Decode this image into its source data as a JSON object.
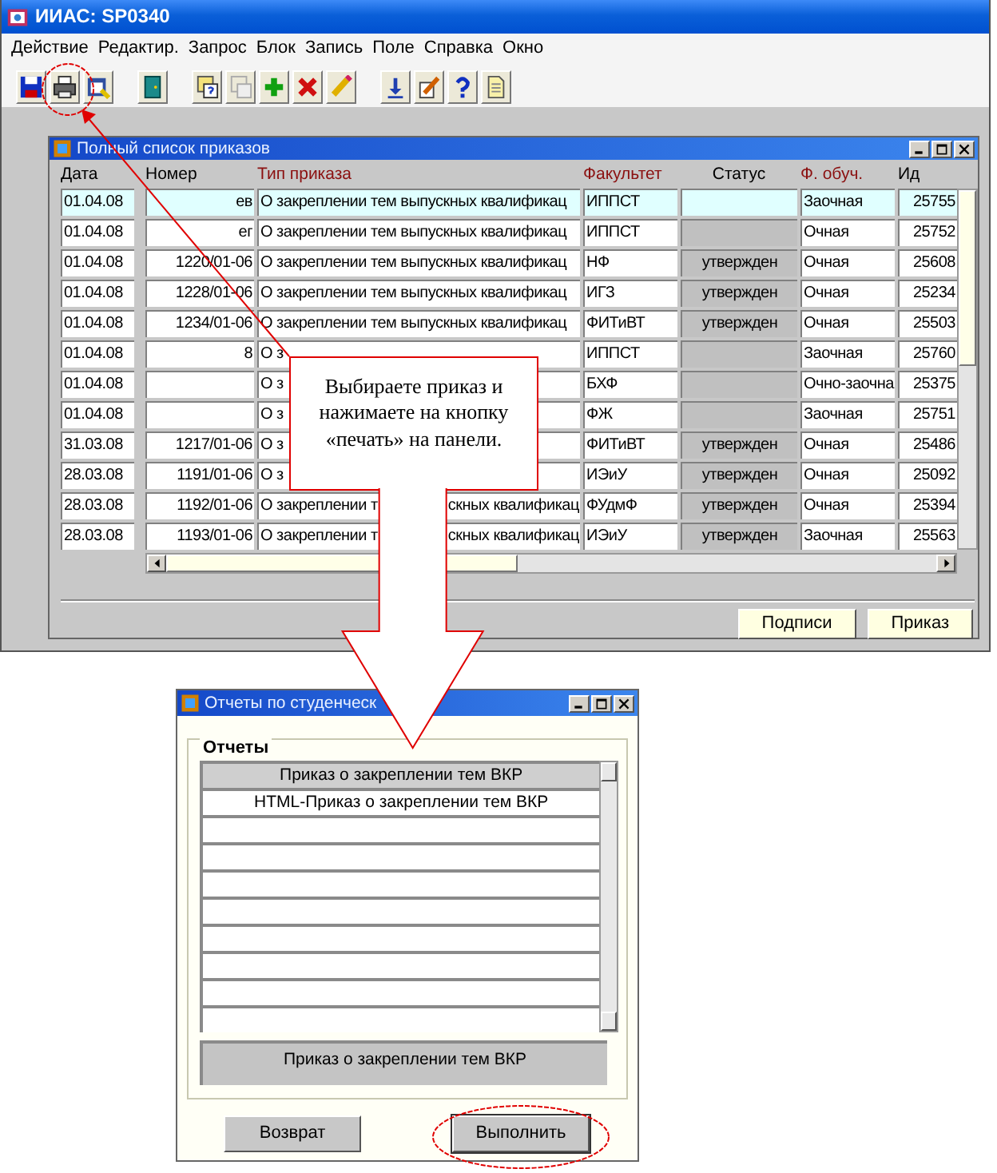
{
  "window": {
    "title": "ИИАС: SP0340"
  },
  "menu": [
    "Действие",
    "Редактир.",
    "Запрос",
    "Блок",
    "Запись",
    "Поле",
    "Справка",
    "Окно"
  ],
  "orders_window": {
    "title": "Полный список приказов",
    "columns": [
      {
        "label": "Дата",
        "emphasized": false
      },
      {
        "label": "Номер",
        "emphasized": false
      },
      {
        "label": "Тип приказа",
        "emphasized": true
      },
      {
        "label": "Факультет",
        "emphasized": true
      },
      {
        "label": "Статус",
        "emphasized": false
      },
      {
        "label": "Ф. обуч.",
        "emphasized": true
      },
      {
        "label": "Ид",
        "emphasized": false
      }
    ],
    "rows": [
      {
        "date": "01.04.08",
        "number": "ев",
        "type": "О закреплении тем выпускных квалификац",
        "faculty": "ИППСТ",
        "form": "Заочная",
        "id": "25755",
        "selected": true
      },
      {
        "date": "01.04.08",
        "number": "ег",
        "type": "О закреплении тем выпускных квалификац",
        "faculty": "ИППСТ",
        "form": "Очная",
        "id": "25752",
        "selected": false
      },
      {
        "date": "01.04.08",
        "number": "1220/01-06",
        "type": "О закреплении тем выпускных квалификац",
        "faculty": "НФ",
        "status": "утвержден",
        "form": "Очная",
        "id": "25608",
        "selected": false
      },
      {
        "date": "01.04.08",
        "number": "1228/01-06",
        "type": "О закреплении тем выпускных квалификац",
        "faculty": "ИГЗ",
        "status": "утвержден",
        "form": "Очная",
        "id": "25234",
        "selected": false
      },
      {
        "date": "01.04.08",
        "number": "1234/01-06",
        "type": "О закреплении тем выпускных квалификац",
        "faculty": "ФИТиВТ",
        "status": "утвержден",
        "form": "Очная",
        "id": "25503",
        "selected": false
      },
      {
        "date": "01.04.08",
        "number": "8",
        "type": "О з",
        "faculty": "ИППСТ",
        "form": "Заочная",
        "id": "25760",
        "selected": false
      },
      {
        "date": "01.04.08",
        "type": "О з",
        "faculty": "БХФ",
        "form": "Очно-заочна",
        "id": "25375",
        "selected": false
      },
      {
        "date": "01.04.08",
        "type": "О з",
        "faculty": "ФЖ",
        "form": "Заочная",
        "id": "25751",
        "selected": false
      },
      {
        "date": "31.03.08",
        "number": "1217/01-06",
        "type": "О з",
        "faculty": "ФИТиВТ",
        "status": "утвержден",
        "form": "Очная",
        "id": "25486",
        "selected": false
      },
      {
        "date": "28.03.08",
        "number": "1191/01-06",
        "type": "О з",
        "faculty": "ИЭиУ",
        "status": "утвержден",
        "form": "Очная",
        "id": "25092",
        "selected": false
      },
      {
        "date": "28.03.08",
        "number": "1192/01-06",
        "type": "О закреплении т",
        "type_tail": "скных квалификац",
        "faculty": "ФУдмФ",
        "status": "утвержден",
        "form": "Очная",
        "id": "25394",
        "selected": false
      },
      {
        "date": "28.03.08",
        "number": "1193/01-06",
        "type": "О закреплении т",
        "type_tail": "скных квалификац",
        "faculty": "ИЭиУ",
        "status": "утвержден",
        "form": "Заочная",
        "id": "25563",
        "selected": false
      }
    ],
    "buttons": [
      "Подписи",
      "Приказ"
    ]
  },
  "callout": {
    "text": "Выбираете приказ и нажимаете на кнопку «печать» на панели."
  },
  "reports_dialog": {
    "title": "Отчеты по студенческ",
    "group_label": "Отчеты",
    "items": [
      {
        "label": "Приказ о закреплении тем ВКР",
        "selected": true
      },
      {
        "label": "HTML-Приказ о закреплении тем ВКР",
        "selected": false
      }
    ],
    "current_report": "Приказ о закреплении тем ВКР",
    "buttons": [
      {
        "label": "Возврат",
        "default": false
      },
      {
        "label": "Выполнить",
        "default": true
      }
    ]
  }
}
